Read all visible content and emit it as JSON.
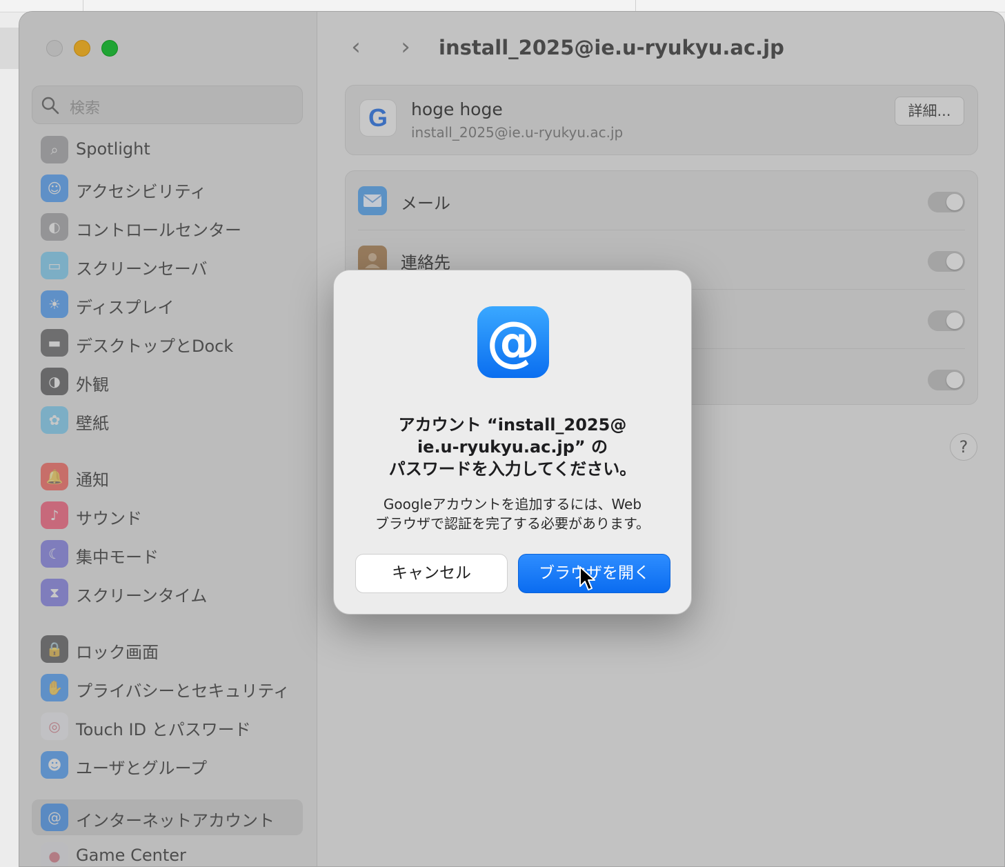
{
  "window": {
    "title": "install_2025@ie.u-ryukyu.ac.jp",
    "nav": {
      "back_icon": "chevron-left-icon",
      "forward_icon": "chevron-right-icon"
    }
  },
  "sidebar": {
    "search_placeholder": "検索",
    "items": [
      {
        "label": "Spotlight",
        "icon": "magnifier-icon",
        "color": "#8e8e93"
      },
      {
        "label": "アクセシビリティ",
        "icon": "accessibility-icon",
        "color": "#1a84ff"
      },
      {
        "label": "コントロールセンター",
        "icon": "toggles-icon",
        "color": "#8e8e93"
      },
      {
        "label": "スクリーンセーバ",
        "icon": "screensaver-icon",
        "color": "#5ac8fa"
      },
      {
        "label": "ディスプレイ",
        "icon": "sun-icon",
        "color": "#1a84ff"
      },
      {
        "label": "デスクトップとDock",
        "icon": "dock-icon",
        "color": "#3a3a3c"
      },
      {
        "label": "外観",
        "icon": "appearance-icon",
        "color": "#2c2c2e"
      },
      {
        "label": "壁紙",
        "icon": "flower-icon",
        "color": "#5ac8fa"
      },
      {
        "label": "通知",
        "icon": "bell-icon",
        "color": "#ff3b30"
      },
      {
        "label": "サウンド",
        "icon": "speaker-icon",
        "color": "#ff2d55"
      },
      {
        "label": "集中モード",
        "icon": "moon-icon",
        "color": "#5e5ce6"
      },
      {
        "label": "スクリーンタイム",
        "icon": "hourglass-icon",
        "color": "#5e5ce6"
      },
      {
        "label": "ロック画面",
        "icon": "lock-icon",
        "color": "#2c2c2e"
      },
      {
        "label": "プライバシーとセキュリティ",
        "icon": "hand-icon",
        "color": "#1a84ff"
      },
      {
        "label": "Touch ID とパスワード",
        "icon": "fingerprint-icon",
        "color": "#f2f2f7"
      },
      {
        "label": "ユーザとグループ",
        "icon": "users-icon",
        "color": "#1a84ff"
      },
      {
        "label": "インターネットアカウント",
        "icon": "at-icon",
        "color": "#1a84ff",
        "active": true
      },
      {
        "label": "Game Center",
        "icon": "gamecenter-icon",
        "color": "#e5e5ea"
      }
    ]
  },
  "account": {
    "provider_icon": "google-icon",
    "provider_glyph": "G",
    "name": "hoge hoge",
    "email": "install_2025@ie.u-ryukyu.ac.jp",
    "details_button": "詳細..."
  },
  "services": [
    {
      "label": "メール",
      "icon": "mail-icon",
      "color": "#5aa9f5",
      "enabled": true
    },
    {
      "label": "連絡先",
      "icon": "contacts-icon",
      "color": "#b5895b",
      "enabled": true
    },
    {
      "label": "",
      "icon": "calendar-icon",
      "enabled": true
    },
    {
      "label": "",
      "icon": "notes-icon",
      "enabled": true
    }
  ],
  "help_button": "?",
  "dialog": {
    "icon": "at-icon",
    "icon_glyph": "@",
    "title_lines": [
      "アカウント “install_2025@",
      "ie.u-ryukyu.ac.jp” の",
      "パスワードを入力してください。"
    ],
    "message_lines": [
      "Googleアカウントを追加するには、Web",
      "ブラウザで認証を完了する必要があります。"
    ],
    "cancel_button": "キャンセル",
    "open_browser_button": "ブラウザを開く"
  }
}
